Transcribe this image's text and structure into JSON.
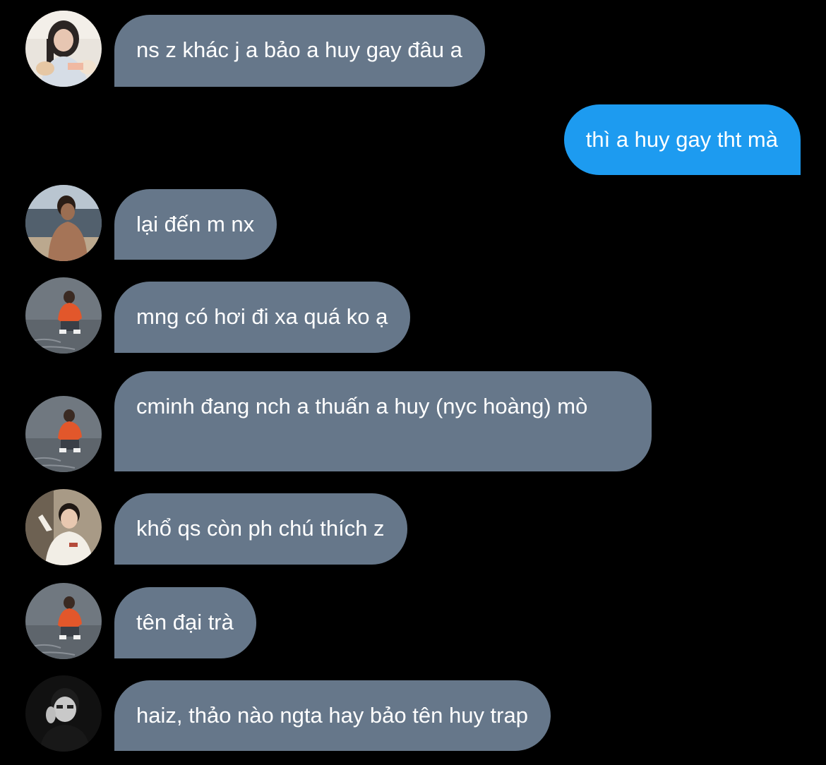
{
  "conversation": {
    "messages": [
      {
        "sender": "avatar-girl",
        "direction": "incoming",
        "text": "ns z khác j a bảo a huy gay đâu a"
      },
      {
        "sender": "me",
        "direction": "outgoing",
        "text": "thì a huy gay tht mà"
      },
      {
        "sender": "avatar-beach",
        "direction": "incoming",
        "text": "lại đến m nx"
      },
      {
        "sender": "avatar-orange-shirt",
        "direction": "incoming",
        "text": "mng có hơi đi xa quá ko ạ"
      },
      {
        "sender": "avatar-orange-shirt",
        "direction": "incoming",
        "text": "cminh đang nch a thuấn a huy (nyc hoàng) mò"
      },
      {
        "sender": "avatar-white-sweater",
        "direction": "incoming",
        "text": "khổ qs còn ph chú thích z"
      },
      {
        "sender": "avatar-orange-shirt",
        "direction": "incoming",
        "text": "tên đại trà"
      },
      {
        "sender": "avatar-dark-photo",
        "direction": "incoming",
        "text": "haiz, thảo nào ngta hay bảo tên huy trap"
      }
    ]
  },
  "colors": {
    "background": "#000000",
    "incoming_bubble": "#66778a",
    "outgoing_bubble": "#1d9bf0",
    "text": "#ffffff"
  }
}
